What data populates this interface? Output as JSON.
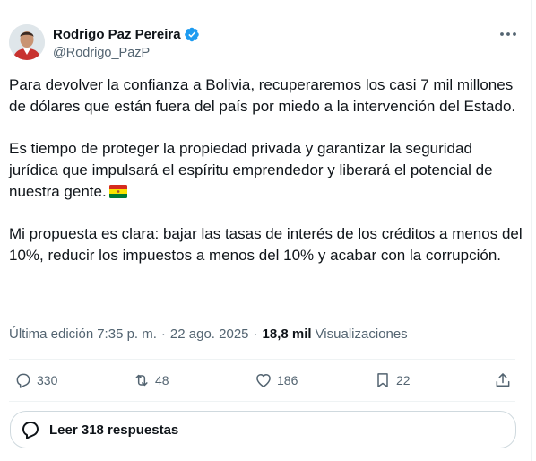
{
  "author": {
    "name": "Rodrigo Paz Pereira",
    "handle": "@Rodrigo_PazP",
    "verified": true
  },
  "post": {
    "paragraphs": [
      "Para devolver la confianza a Bolivia, recuperaremos los casi 7 mil millones de dólares que están fuera del país por miedo a la intervención del Estado.",
      "Es tiempo de proteger la propiedad privada y garantizar la seguridad jurídica que impulsará el espíritu emprendedor y liberará el potencial de nuestra gente.",
      "Mi propuesta es clara: bajar las tasas de interés de los créditos a menos del 10%, reducir los impuestos a menos del 10% y acabar con la corrupción."
    ],
    "emoji": "bolivia-flag"
  },
  "meta": {
    "edited_label": "Última edición",
    "time": "7:35 p. m.",
    "date": "22 ago. 2025",
    "views_count": "18,8 mil",
    "views_label": "Visualizaciones"
  },
  "actions": {
    "reply_count": "330",
    "repost_count": "48",
    "like_count": "186",
    "bookmark_count": "22"
  },
  "read_replies": {
    "label": "Leer 318 respuestas"
  },
  "colors": {
    "text_primary": "#0f1419",
    "text_secondary": "#536471",
    "verified_blue": "#1d9bf0",
    "border": "#cfd9de"
  }
}
